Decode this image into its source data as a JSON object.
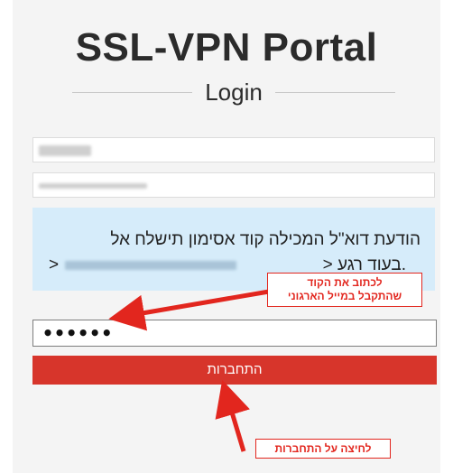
{
  "header": {
    "title": "SSL-VPN Portal",
    "subtitle": "Login"
  },
  "notice": {
    "line1": "הודעת דוא\"ל המכילה קוד אסימון תישלח אל",
    "line2": ".בעוד רגע <",
    "line2_prefix": "<"
  },
  "form": {
    "code_value": "••••••",
    "login_label": "התחברות"
  },
  "annotations": {
    "code_note_line1": "לכתוב את הקוד",
    "code_note_line2": "שהתקבל במייל הארגוני",
    "login_note": "לחיצה על התחברות"
  },
  "colors": {
    "button": "#d7352b",
    "notice_bg": "#d6ecfa",
    "annotation": "#e2261e"
  }
}
